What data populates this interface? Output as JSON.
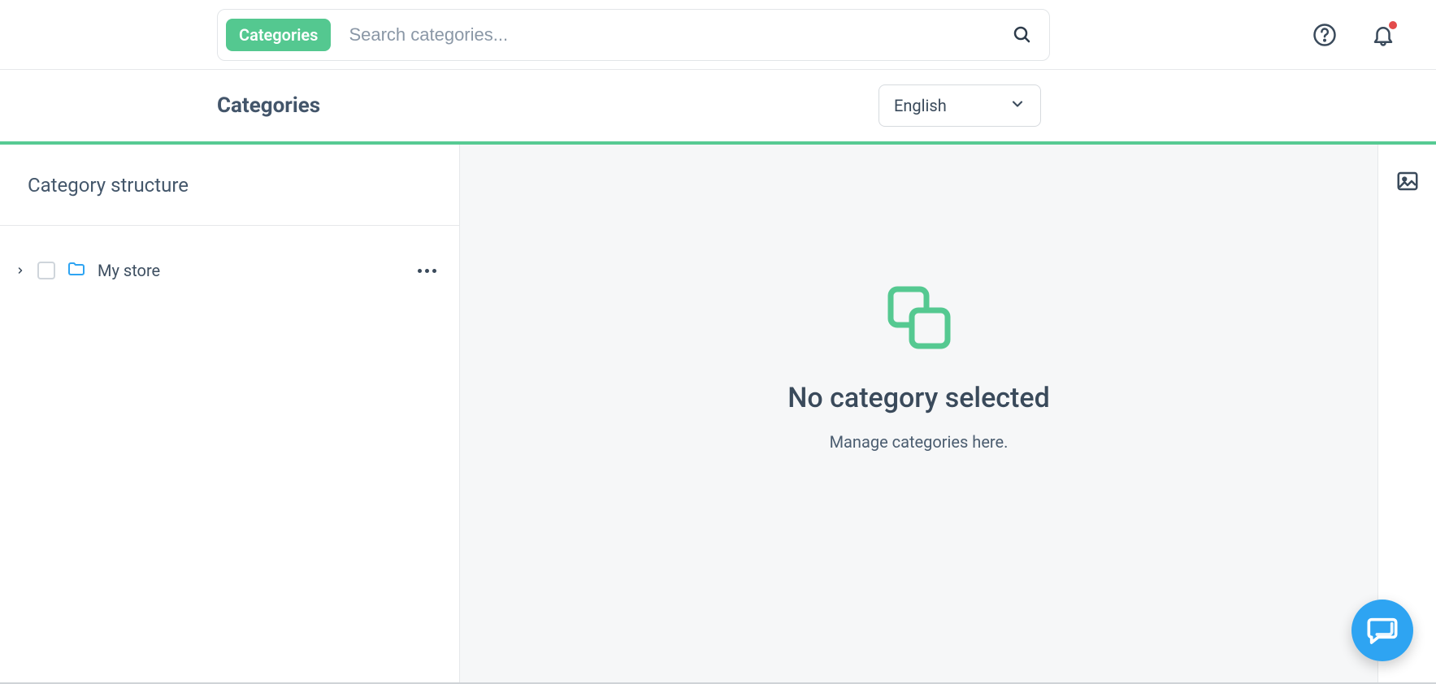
{
  "header": {
    "search_tag": "Categories",
    "search_placeholder": "Search categories..."
  },
  "page": {
    "title": "Categories",
    "language": "English"
  },
  "sidebar": {
    "heading": "Category structure",
    "tree": [
      {
        "label": "My store"
      }
    ]
  },
  "empty": {
    "title": "No category selected",
    "subtitle": "Manage categories here."
  }
}
